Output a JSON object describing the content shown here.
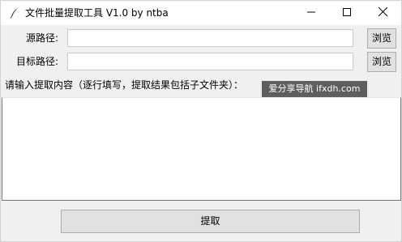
{
  "window": {
    "title": "文件批量提取工具 V1.0 by ntba",
    "icon": "feather-icon"
  },
  "controls": {
    "minimize": "minimize-icon",
    "maximize": "maximize-icon",
    "close": "close-icon"
  },
  "source": {
    "label": "源路径:",
    "value": "",
    "browse_label": "浏览"
  },
  "target": {
    "label": "目标路径:",
    "value": "",
    "browse_label": "浏览"
  },
  "content": {
    "hint": "请输入提取内容（逐行填写，提取结果包括子文件夹）：",
    "value": ""
  },
  "watermark": "爱分享导航 ifxdh.com",
  "extract_button": "提取"
}
